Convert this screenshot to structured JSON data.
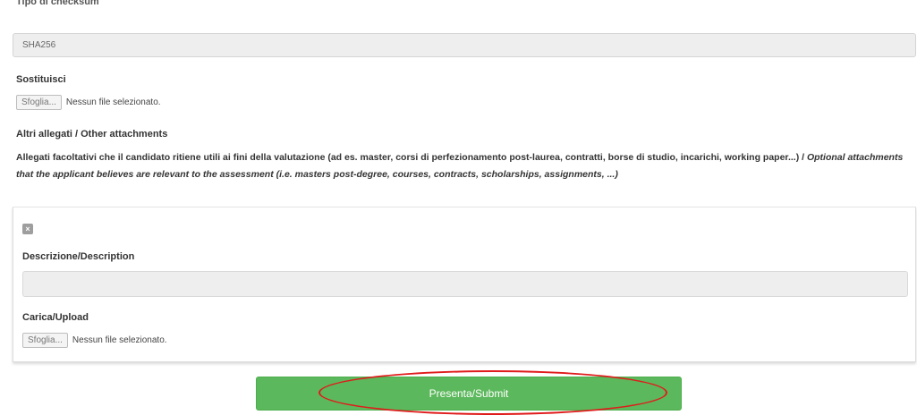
{
  "checksum": {
    "label": "Tipo di checksum",
    "value": "SHA256"
  },
  "replace": {
    "label": "Sostituisci",
    "file_button": "Sfoglia...",
    "file_status": "Nessun file selezionato."
  },
  "attachments": {
    "heading": "Altri allegati / Other attachments",
    "description_it": "Allegati facoltativi che il candidato ritiene utili ai fini della valutazione (ad es. master, corsi di perfezionamento post-laurea, contratti, borse di studio, incarichi, working paper...) / ",
    "description_en": "Optional attachments that the applicant believes are relevant to the assessment (i.e. masters post-degree, courses, contracts, scholarships, assignments, ...)"
  },
  "attachment_item": {
    "remove_icon": "x-icon",
    "description_label": "Descrizione/Description",
    "description_value": "",
    "upload_label": "Carica/Upload",
    "file_button": "Sfoglia...",
    "file_status": "Nessun file selezionato."
  },
  "submit": {
    "label": "Presenta/Submit"
  },
  "colors": {
    "submit_bg": "#5cb85c",
    "highlight": "#e01b1b"
  }
}
